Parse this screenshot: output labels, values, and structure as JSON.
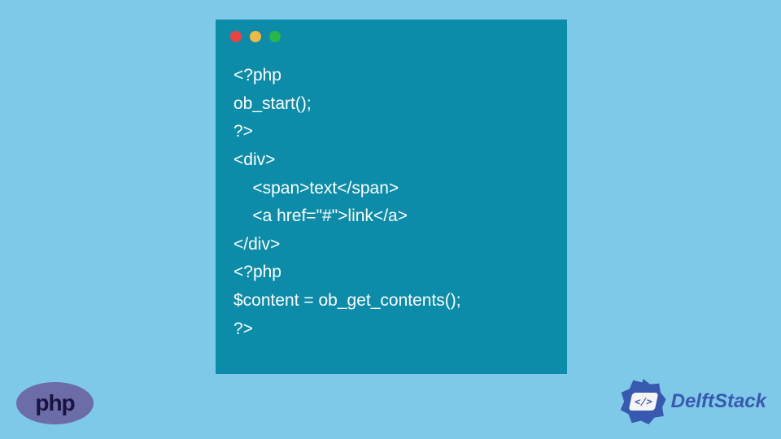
{
  "code": {
    "line1": "<?php",
    "line2": "ob_start();",
    "line3": "?>",
    "line4": "<div>",
    "line5": "    <span>text</span>",
    "line6": "    <a href=\"#\">link</a>",
    "line7": "</div>",
    "line8": "<?php",
    "line9": "$content = ob_get_contents();",
    "line10": "?>"
  },
  "logos": {
    "php": "php",
    "delftstack": "DelftStack",
    "badge_symbol": "</>"
  }
}
